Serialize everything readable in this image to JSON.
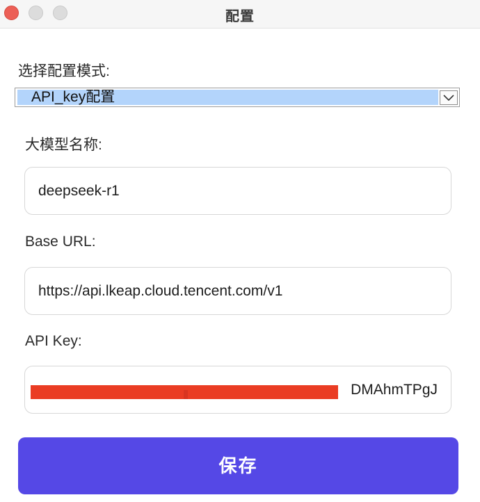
{
  "window": {
    "title": "配置"
  },
  "mode": {
    "label": "选择配置模式:",
    "selected": "API_key配置"
  },
  "fields": {
    "model_label": "大模型名称:",
    "model_value": "deepseek-r1",
    "base_url_label": "Base URL:",
    "base_url_value": "https://api.lkeap.cloud.tencent.com/v1",
    "api_key_label": "API Key:",
    "api_key_visible_tail": "DMAhmTPgJ"
  },
  "actions": {
    "save_label": "保存"
  },
  "colors": {
    "accent": "#5548e6",
    "selection": "#b3d4fb",
    "redaction": "#ea3c23",
    "close_button": "#ec5f56"
  }
}
